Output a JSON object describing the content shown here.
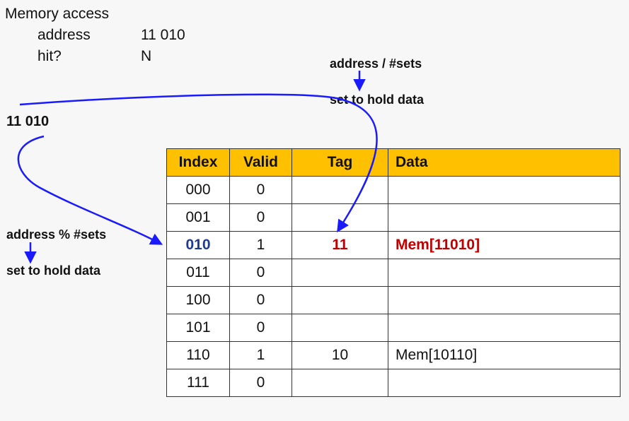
{
  "header": {
    "title": "Memory access",
    "address_label": "address",
    "address_value": "11 010",
    "hit_label": "hit?",
    "hit_value": "N"
  },
  "annotations": {
    "addr_input": "11 010",
    "tag_rule_top": "address / #sets",
    "tag_rule_bottom": "set to hold data",
    "index_rule_top": "address % #sets",
    "index_rule_bottom": "set to hold data"
  },
  "table": {
    "columns": [
      "Index",
      "Valid",
      "Tag",
      "Data"
    ],
    "rows": [
      {
        "index": "000",
        "valid": "0",
        "tag": "",
        "data": ""
      },
      {
        "index": "001",
        "valid": "0",
        "tag": "",
        "data": ""
      },
      {
        "index": "010",
        "valid": "1",
        "tag": "11",
        "data": "Mem[11010]"
      },
      {
        "index": "011",
        "valid": "0",
        "tag": "",
        "data": ""
      },
      {
        "index": "100",
        "valid": "0",
        "tag": "",
        "data": ""
      },
      {
        "index": "101",
        "valid": "0",
        "tag": "",
        "data": ""
      },
      {
        "index": "110",
        "valid": "1",
        "tag": "10",
        "data": "Mem[10110]"
      },
      {
        "index": "111",
        "valid": "0",
        "tag": "",
        "data": ""
      }
    ]
  },
  "colors": {
    "header_bg": "#ffc000",
    "highlight_index": "#1f3a93",
    "highlight_tag": "#c00000",
    "arrow": "#1a1aff"
  }
}
